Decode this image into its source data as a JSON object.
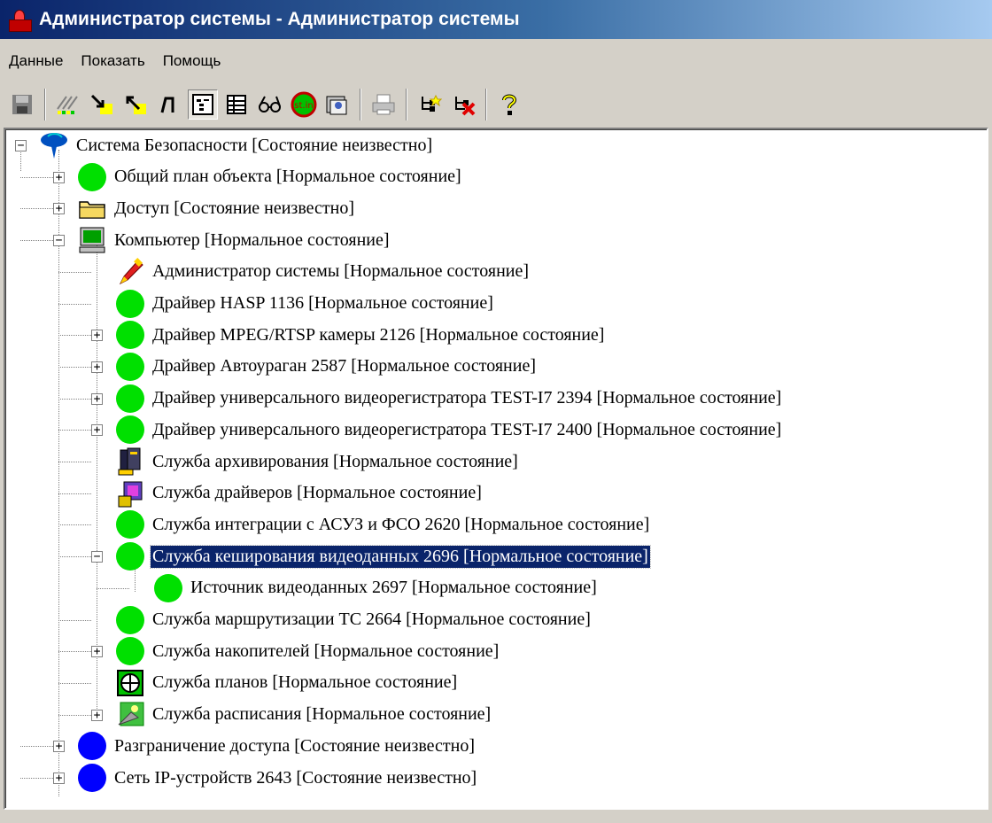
{
  "window": {
    "title": "Администратор системы - Администратор системы"
  },
  "menu": {
    "items": [
      "Данные",
      "Показать",
      "Помощь"
    ]
  },
  "toolbar": {
    "buttons": [
      {
        "icon": "save-icon"
      },
      {
        "icon": "hatch-icon"
      },
      {
        "icon": "arrow-down-right-icon"
      },
      {
        "icon": "arrow-up-left-icon"
      },
      {
        "icon": "pulse-icon"
      },
      {
        "icon": "tree-view-icon",
        "pressed": true
      },
      {
        "icon": "table-view-icon"
      },
      {
        "icon": "glasses-icon"
      },
      {
        "icon": "state-icon"
      },
      {
        "icon": "card-icon"
      },
      {
        "icon": "print-icon"
      },
      {
        "icon": "add-node-icon"
      },
      {
        "icon": "delete-node-icon"
      },
      {
        "icon": "help-icon"
      }
    ],
    "state_icon_text": "st.in"
  },
  "tree": {
    "colors": {
      "selection": "#0a246a",
      "ok": "#00e000",
      "unknown": "#0000ff"
    },
    "nodes": [
      {
        "label": "Система Безопасности [Состояние неизвестно]",
        "icon": "security-system-icon",
        "depth": 0,
        "expander": "minus"
      },
      {
        "label": "Общий план объекта [Нормальное состояние]",
        "icon": "green-circle-icon",
        "depth": 1,
        "expander": "plus"
      },
      {
        "label": "Доступ [Состояние неизвестно]",
        "icon": "folder-icon",
        "depth": 1,
        "expander": "plus"
      },
      {
        "label": "Компьютер [Нормальное состояние]",
        "icon": "computer-icon",
        "depth": 1,
        "expander": "minus"
      },
      {
        "label": "Администратор системы [Нормальное состояние]",
        "icon": "admin-pen-icon",
        "depth": 2,
        "expander": ""
      },
      {
        "label": "Драйвер HASP 1136 [Нормальное состояние]",
        "icon": "green-circle-icon",
        "depth": 2,
        "expander": ""
      },
      {
        "label": "Драйвер MPEG/RTSP камеры 2126 [Нормальное состояние]",
        "icon": "green-circle-icon",
        "depth": 2,
        "expander": "plus"
      },
      {
        "label": "Драйвер Автоураган 2587 [Нормальное состояние]",
        "icon": "green-circle-icon",
        "depth": 2,
        "expander": "plus"
      },
      {
        "label": "Драйвер универсального видеорегистратора TEST-I7 2394 [Нормальное состояние]",
        "icon": "green-circle-icon",
        "depth": 2,
        "expander": "plus"
      },
      {
        "label": "Драйвер универсального видеорегистратора TEST-I7 2400 [Нормальное состояние]",
        "icon": "green-circle-icon",
        "depth": 2,
        "expander": "plus"
      },
      {
        "label": "Служба архивирования [Нормальное состояние]",
        "icon": "archive-icon",
        "depth": 2,
        "expander": ""
      },
      {
        "label": "Служба драйверов [Нормальное состояние]",
        "icon": "drivers-icon",
        "depth": 2,
        "expander": ""
      },
      {
        "label": "Служба интеграции с АСУЗ и ФСО 2620 [Нормальное состояние]",
        "icon": "green-circle-icon",
        "depth": 2,
        "expander": ""
      },
      {
        "label": "Служба кеширования видеоданных 2696 [Нормальное состояние]",
        "icon": "green-circle-icon",
        "depth": 2,
        "expander": "minus",
        "selected": true
      },
      {
        "label": "Источник видеоданных 2697 [Нормальное состояние]",
        "icon": "green-circle-icon",
        "depth": 3,
        "expander": ""
      },
      {
        "label": "Служба маршрутизации ТС 2664 [Нормальное состояние]",
        "icon": "green-circle-icon",
        "depth": 2,
        "expander": ""
      },
      {
        "label": "Служба накопителей [Нормальное состояние]",
        "icon": "green-circle-icon",
        "depth": 2,
        "expander": "plus"
      },
      {
        "label": "Служба планов [Нормальное состояние]",
        "icon": "plans-icon",
        "depth": 2,
        "expander": ""
      },
      {
        "label": "Служба расписания [Нормальное состояние]",
        "icon": "schedule-icon",
        "depth": 2,
        "expander": "plus"
      },
      {
        "label": "Разграничение доступа [Состояние неизвестно]",
        "icon": "blue-circle-icon",
        "depth": 1,
        "expander": "plus"
      },
      {
        "label": "Сеть IP-устройств 2643 [Состояние неизвестно]",
        "icon": "blue-circle-icon",
        "depth": 1,
        "expander": "plus"
      }
    ]
  }
}
